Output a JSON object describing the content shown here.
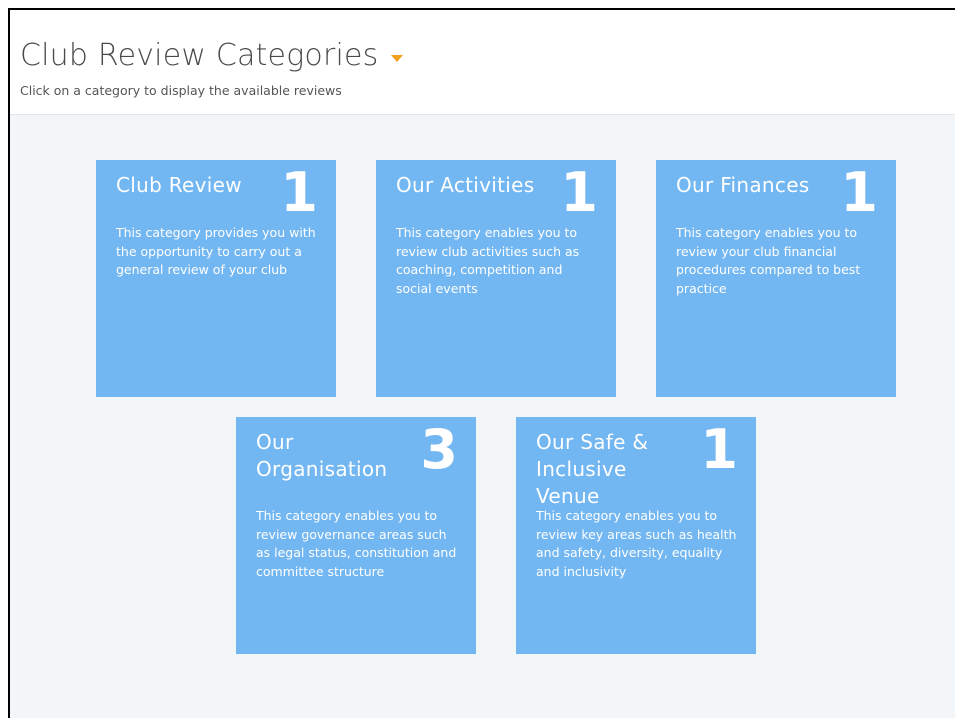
{
  "header": {
    "title": "Club Review Categories",
    "subtitle": "Click on a category to display the available reviews"
  },
  "icons": {
    "dropdown": "caret-down-icon",
    "caret_color": "#f0a01c"
  },
  "colors": {
    "card_background": "#72b6f2",
    "page_background": "#f3f6f9"
  },
  "categories": [
    {
      "title": "Club Review",
      "count": "1",
      "description": "This category provides you with the opportunity to carry out a general review of your club"
    },
    {
      "title": "Our Activities",
      "count": "1",
      "description": "This category enables you to review club activities such as coaching, competition and social events"
    },
    {
      "title": "Our Finances",
      "count": "1",
      "description": "This category enables you to review your club financial procedures compared to best practice"
    },
    {
      "title": "Our Organisation",
      "count": "3",
      "description": "This category enables you to review governance areas such as legal status, constitution and committee structure"
    },
    {
      "title": "Our Safe & Inclusive Venue",
      "count": "1",
      "description": "This category enables you to review key areas such as health and safety, diversity, equality and inclusivity"
    }
  ]
}
